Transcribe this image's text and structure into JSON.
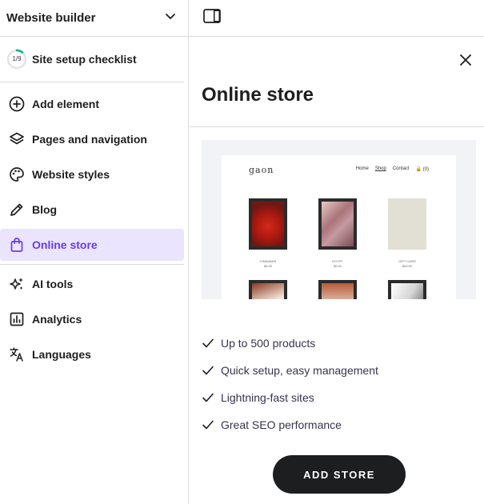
{
  "sidebar": {
    "header_title": "Website builder",
    "checklist": {
      "progress": "1/9",
      "completed": 1,
      "total": 9,
      "label": "Site setup checklist"
    },
    "items": [
      {
        "label": "Add element",
        "icon": "plus-circle-icon"
      },
      {
        "label": "Pages and navigation",
        "icon": "layers-icon"
      },
      {
        "label": "Website styles",
        "icon": "palette-icon"
      },
      {
        "label": "Blog",
        "icon": "pencil-icon"
      },
      {
        "label": "Online store",
        "icon": "shopping-bag-icon",
        "active": true
      },
      {
        "label": "AI tools",
        "icon": "sparkles-icon"
      },
      {
        "label": "Analytics",
        "icon": "chart-icon"
      },
      {
        "label": "Languages",
        "icon": "translate-icon"
      }
    ]
  },
  "panel": {
    "title": "Online store",
    "preview": {
      "logo": "gaon",
      "menu": [
        "Home",
        "Shop",
        "Contact",
        "🔒 (0)"
      ],
      "products": [
        {
          "name": "CINNABAR",
          "price": "$0.00"
        },
        {
          "name": "EGYPT",
          "price": "$0.00"
        },
        {
          "name": "GIFT CARD",
          "price": "$00.00"
        }
      ]
    },
    "features": [
      "Up to 500 products",
      "Quick setup, easy management",
      "Lightning-fast sites",
      "Great SEO performance"
    ],
    "add_button": "ADD STORE"
  },
  "colors": {
    "accent": "#673de6",
    "active_bg": "#ebe4ff",
    "button_bg": "#1d1e20",
    "progress_ring": "#00b090"
  }
}
